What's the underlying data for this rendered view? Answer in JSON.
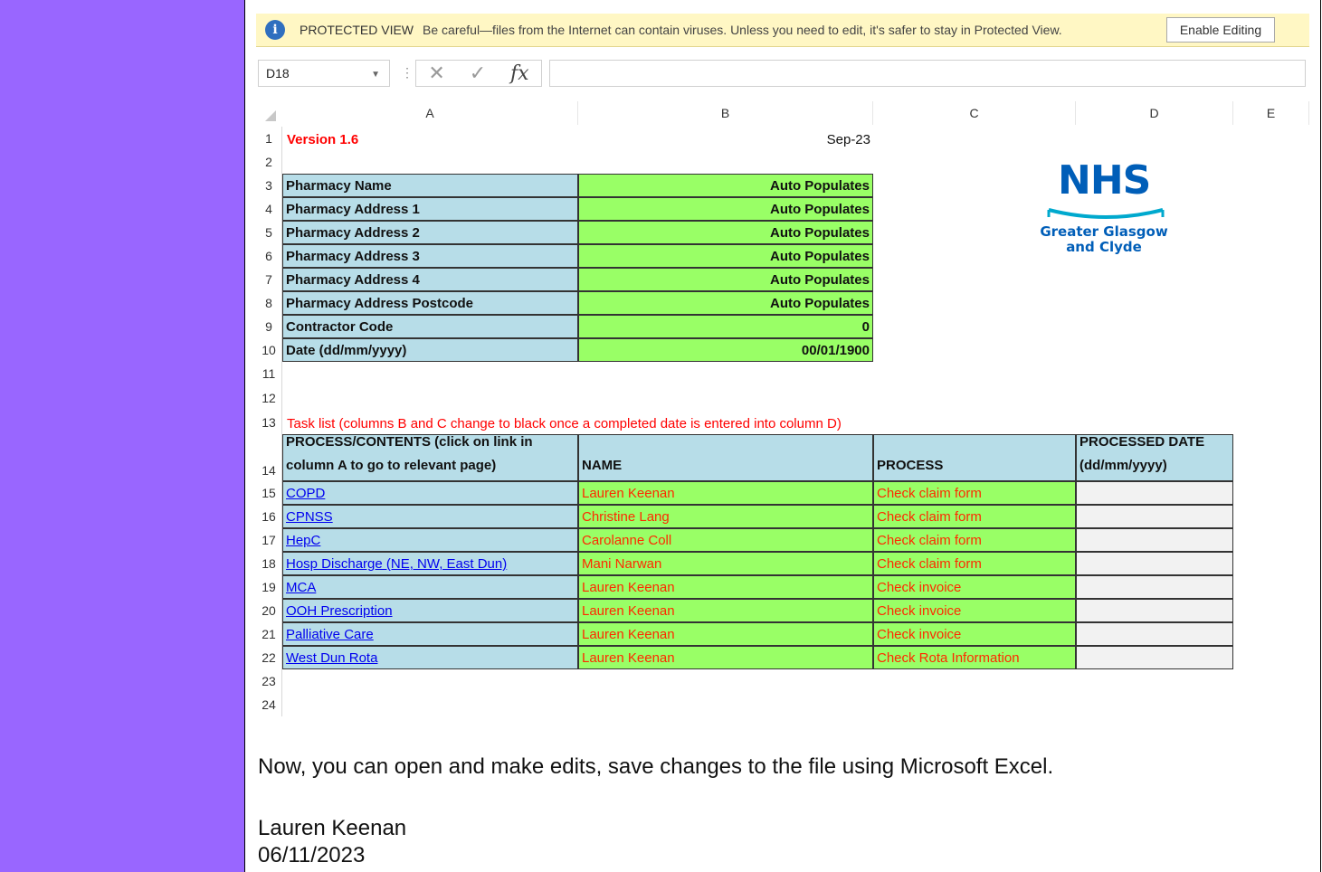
{
  "protected_view": {
    "title": "PROTECTED VIEW",
    "message": "Be careful—files from the Internet can contain viruses. Unless you need to edit, it's safer to stay in Protected View.",
    "button": "Enable Editing"
  },
  "formula_bar": {
    "name_box": "D18",
    "formula": ""
  },
  "columns": [
    "A",
    "B",
    "C",
    "D",
    "E"
  ],
  "rows": [
    "1",
    "2",
    "3",
    "4",
    "5",
    "6",
    "7",
    "8",
    "9",
    "10",
    "11",
    "12",
    "13",
    "14",
    "15",
    "16",
    "17",
    "18",
    "19",
    "20",
    "21",
    "22",
    "23",
    "24"
  ],
  "header_block": {
    "version": "Version 1.6",
    "date_label": "Sep-23"
  },
  "info_table": [
    {
      "label": "Pharmacy Name",
      "value": "Auto Populates"
    },
    {
      "label": "Pharmacy Address 1",
      "value": "Auto Populates"
    },
    {
      "label": "Pharmacy Address 2",
      "value": "Auto Populates"
    },
    {
      "label": "Pharmacy Address 3",
      "value": "Auto Populates"
    },
    {
      "label": "Pharmacy Address 4",
      "value": "Auto Populates"
    },
    {
      "label": "Pharmacy Address Postcode",
      "value": "Auto Populates"
    },
    {
      "label": "Contractor Code",
      "value": "0"
    },
    {
      "label": "Date  (dd/mm/yyyy)",
      "value": "00/01/1900"
    }
  ],
  "task_note": "Task list (columns B and C change to black once a completed date is entered into column D)",
  "task_headers": {
    "a": "PROCESS/CONTENTS (click on link in column A to go to relevant page)",
    "b": "NAME",
    "c": "PROCESS",
    "d": "PROCESSED DATE (dd/mm/yyyy)"
  },
  "tasks": [
    {
      "link": "COPD",
      "name": "Lauren Keenan",
      "process": "Check claim form",
      "date": ""
    },
    {
      "link": "CPNSS",
      "name": "Christine Lang",
      "process": "Check claim form",
      "date": ""
    },
    {
      "link": "HepC",
      "name": "Carolanne Coll",
      "process": "Check claim form",
      "date": ""
    },
    {
      "link": "Hosp Discharge (NE, NW, East Dun)",
      "name": "Mani Narwan",
      "process": "Check claim form",
      "date": ""
    },
    {
      "link": "MCA",
      "name": "Lauren Keenan",
      "process": "Check invoice",
      "date": ""
    },
    {
      "link": "OOH Prescription",
      "name": "Lauren Keenan",
      "process": "Check invoice",
      "date": ""
    },
    {
      "link": "Palliative Care",
      "name": "Lauren Keenan",
      "process": "Check invoice",
      "date": ""
    },
    {
      "link": "West Dun Rota",
      "name": "Lauren Keenan",
      "process": "Check Rota Information",
      "date": ""
    }
  ],
  "logo": {
    "word": "NHS",
    "sub1": "Greater Glasgow",
    "sub2": "and Clyde"
  },
  "notes": {
    "line1": "Now, you can open and make edits, save changes to the file using Microsoft Excel.",
    "author": "Lauren Keenan",
    "date": "06/11/2023"
  },
  "colors": {
    "sidebar": "#9966ff",
    "label_fill": "#b7dde8",
    "green_fill": "#99ff66",
    "pv_bar": "#fff7c4"
  }
}
